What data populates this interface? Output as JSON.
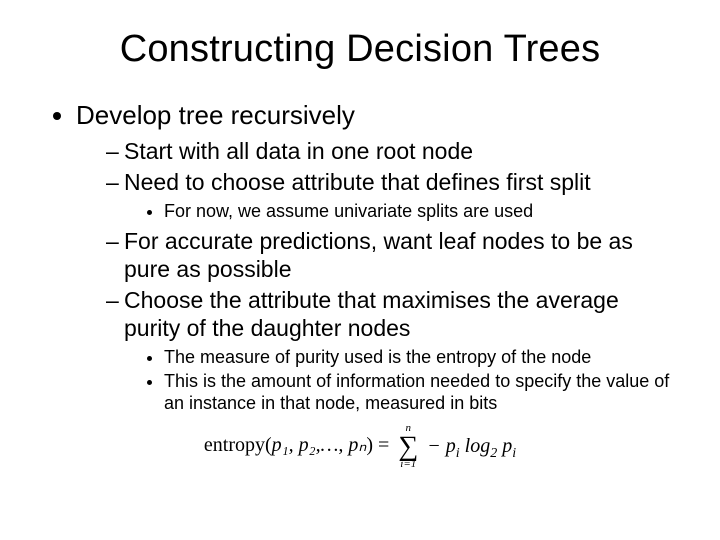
{
  "title": "Constructing Decision Trees",
  "b1": "Develop tree recursively",
  "b1_1": "Start with all data in one root node",
  "b1_2": "Need to choose attribute that defines first split",
  "b1_2_1": "For now, we assume univariate splits are used",
  "b1_3": "For accurate predictions, want leaf nodes to be as pure as possible",
  "b1_4": "Choose the attribute that maximises the average purity of the daughter nodes",
  "b1_4_1": "The measure of purity used is the entropy of the node",
  "b1_4_2": "This is the amount of information needed to specify the value of an instance in that node, measured in bits",
  "formula": {
    "fn": "entropy",
    "args": "p₁, p₂,…, pₙ",
    "sum_top": "n",
    "sum_bot": "i=1",
    "body_prefix": "− p",
    "body_sub1": "i",
    "body_mid": " log",
    "body_sub2": "2",
    "body_suffix": " p",
    "body_sub3": "i"
  }
}
